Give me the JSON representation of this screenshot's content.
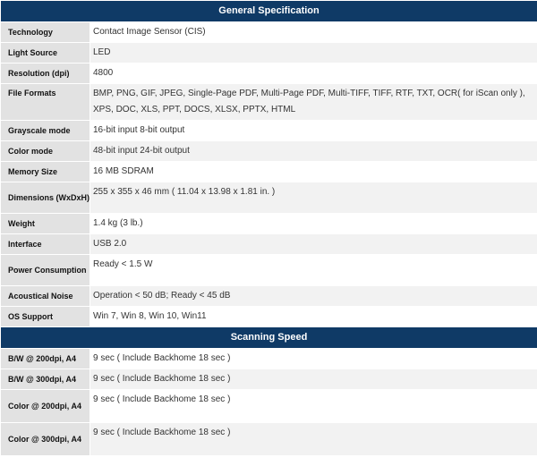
{
  "general": {
    "title": "General Specification",
    "rows": [
      {
        "label": "Technology",
        "value": "Contact Image Sensor (CIS)"
      },
      {
        "label": "Light Source",
        "value": "LED"
      },
      {
        "label": "Resolution (dpi)",
        "value": "4800"
      },
      {
        "label": "File Formats",
        "value": "BMP, PNG, GIF, JPEG, Single-Page PDF, Multi-Page PDF, Multi-TIFF, TIFF, RTF, TXT, OCR( for iScan only ), XPS, DOC, XLS, PPT, DOCS, XLSX, PPTX, HTML"
      },
      {
        "label": "Grayscale mode",
        "value": "16-bit input 8-bit output"
      },
      {
        "label": "Color mode",
        "value": "48-bit input 24-bit output"
      },
      {
        "label": "Memory Size",
        "value": "16 MB SDRAM"
      },
      {
        "label": "Dimensions (WxDxH)",
        "value": "255 x 355 x 46 mm ( 11.04 x 13.98 x 1.81 in. )"
      },
      {
        "label": "Weight",
        "value": "1.4 kg (3 lb.)"
      },
      {
        "label": "Interface",
        "value": "USB 2.0"
      },
      {
        "label": "Power Consumption",
        "value": "Ready < 1.5 W"
      },
      {
        "label": "Acoustical Noise",
        "value": "Operation < 50 dB;  Ready < 45 dB"
      },
      {
        "label": "OS Support",
        "value": "Win 7, Win 8, Win 10, Win11"
      }
    ]
  },
  "scanning": {
    "title": "Scanning Speed",
    "rows": [
      {
        "label": "B/W @ 200dpi, A4",
        "value": "9 sec ( Include Backhome 18 sec )"
      },
      {
        "label": "B/W @ 300dpi, A4",
        "value": "9 sec ( Include Backhome 18 sec )"
      },
      {
        "label": "Color @ 200dpi, A4",
        "value": "9 sec ( Include Backhome 18 sec )"
      },
      {
        "label": "Color @ 300dpi, A4",
        "value": "9 sec ( Include Backhome 18 sec )"
      }
    ]
  },
  "colors": {
    "header_bg": "#0f3a66",
    "label_bg": "#e2e2e2",
    "row_shade": "#f2f2f2"
  }
}
